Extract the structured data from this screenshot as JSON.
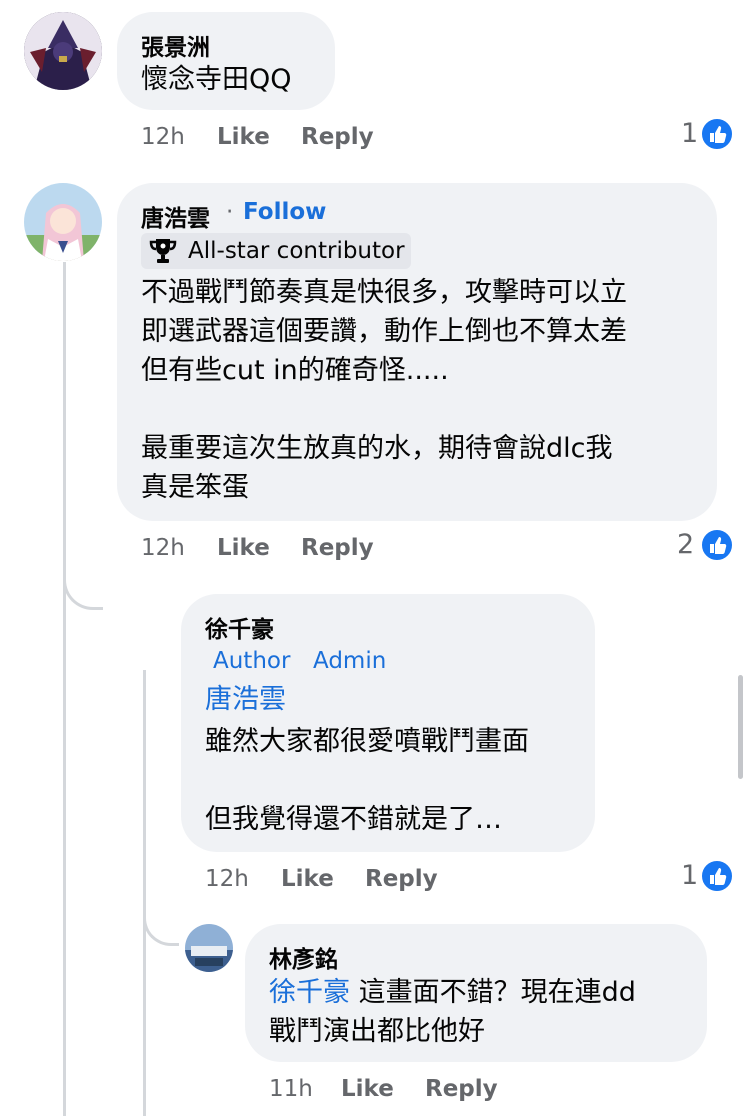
{
  "comments": [
    {
      "author": "張景洲",
      "text": "懷念寺田QQ",
      "time": "12h",
      "like": "Like",
      "reply": "Reply",
      "reactions": "1"
    },
    {
      "author": "唐浩雲",
      "separator": "·",
      "follow": "Follow",
      "badge": "All-star contributor",
      "text_lines": [
        "不過戰鬥節奏真是快很多，攻擊時可以立",
        "即選武器這個要讚，動作上倒也不算太差",
        "但有些cut in的確奇怪.....",
        "",
        "最重要這次生放真的水，期待會說dlc我",
        "真是笨蛋"
      ],
      "time": "12h",
      "like": "Like",
      "reply": "Reply",
      "reactions": "2"
    },
    {
      "author": "徐千豪",
      "tags": [
        "Author",
        "Admin"
      ],
      "mention": "唐浩雲",
      "text_lines": [
        "雖然大家都很愛噴戰鬥畫面",
        "",
        "但我覺得還不錯就是了…"
      ],
      "time": "12h",
      "like": "Like",
      "reply": "Reply",
      "reactions": "1"
    },
    {
      "author": "林彥銘",
      "mention": "徐千豪",
      "text_first": " 這畫面不錯？現在連dd",
      "text_second": "戰鬥演出都比他好",
      "time": "11h",
      "like": "Like",
      "reply": "Reply"
    }
  ],
  "colors": {
    "bubble": "#f0f2f5",
    "link": "#1a6fd9",
    "like_badge": "#1877f2",
    "meta": "#65676b"
  }
}
